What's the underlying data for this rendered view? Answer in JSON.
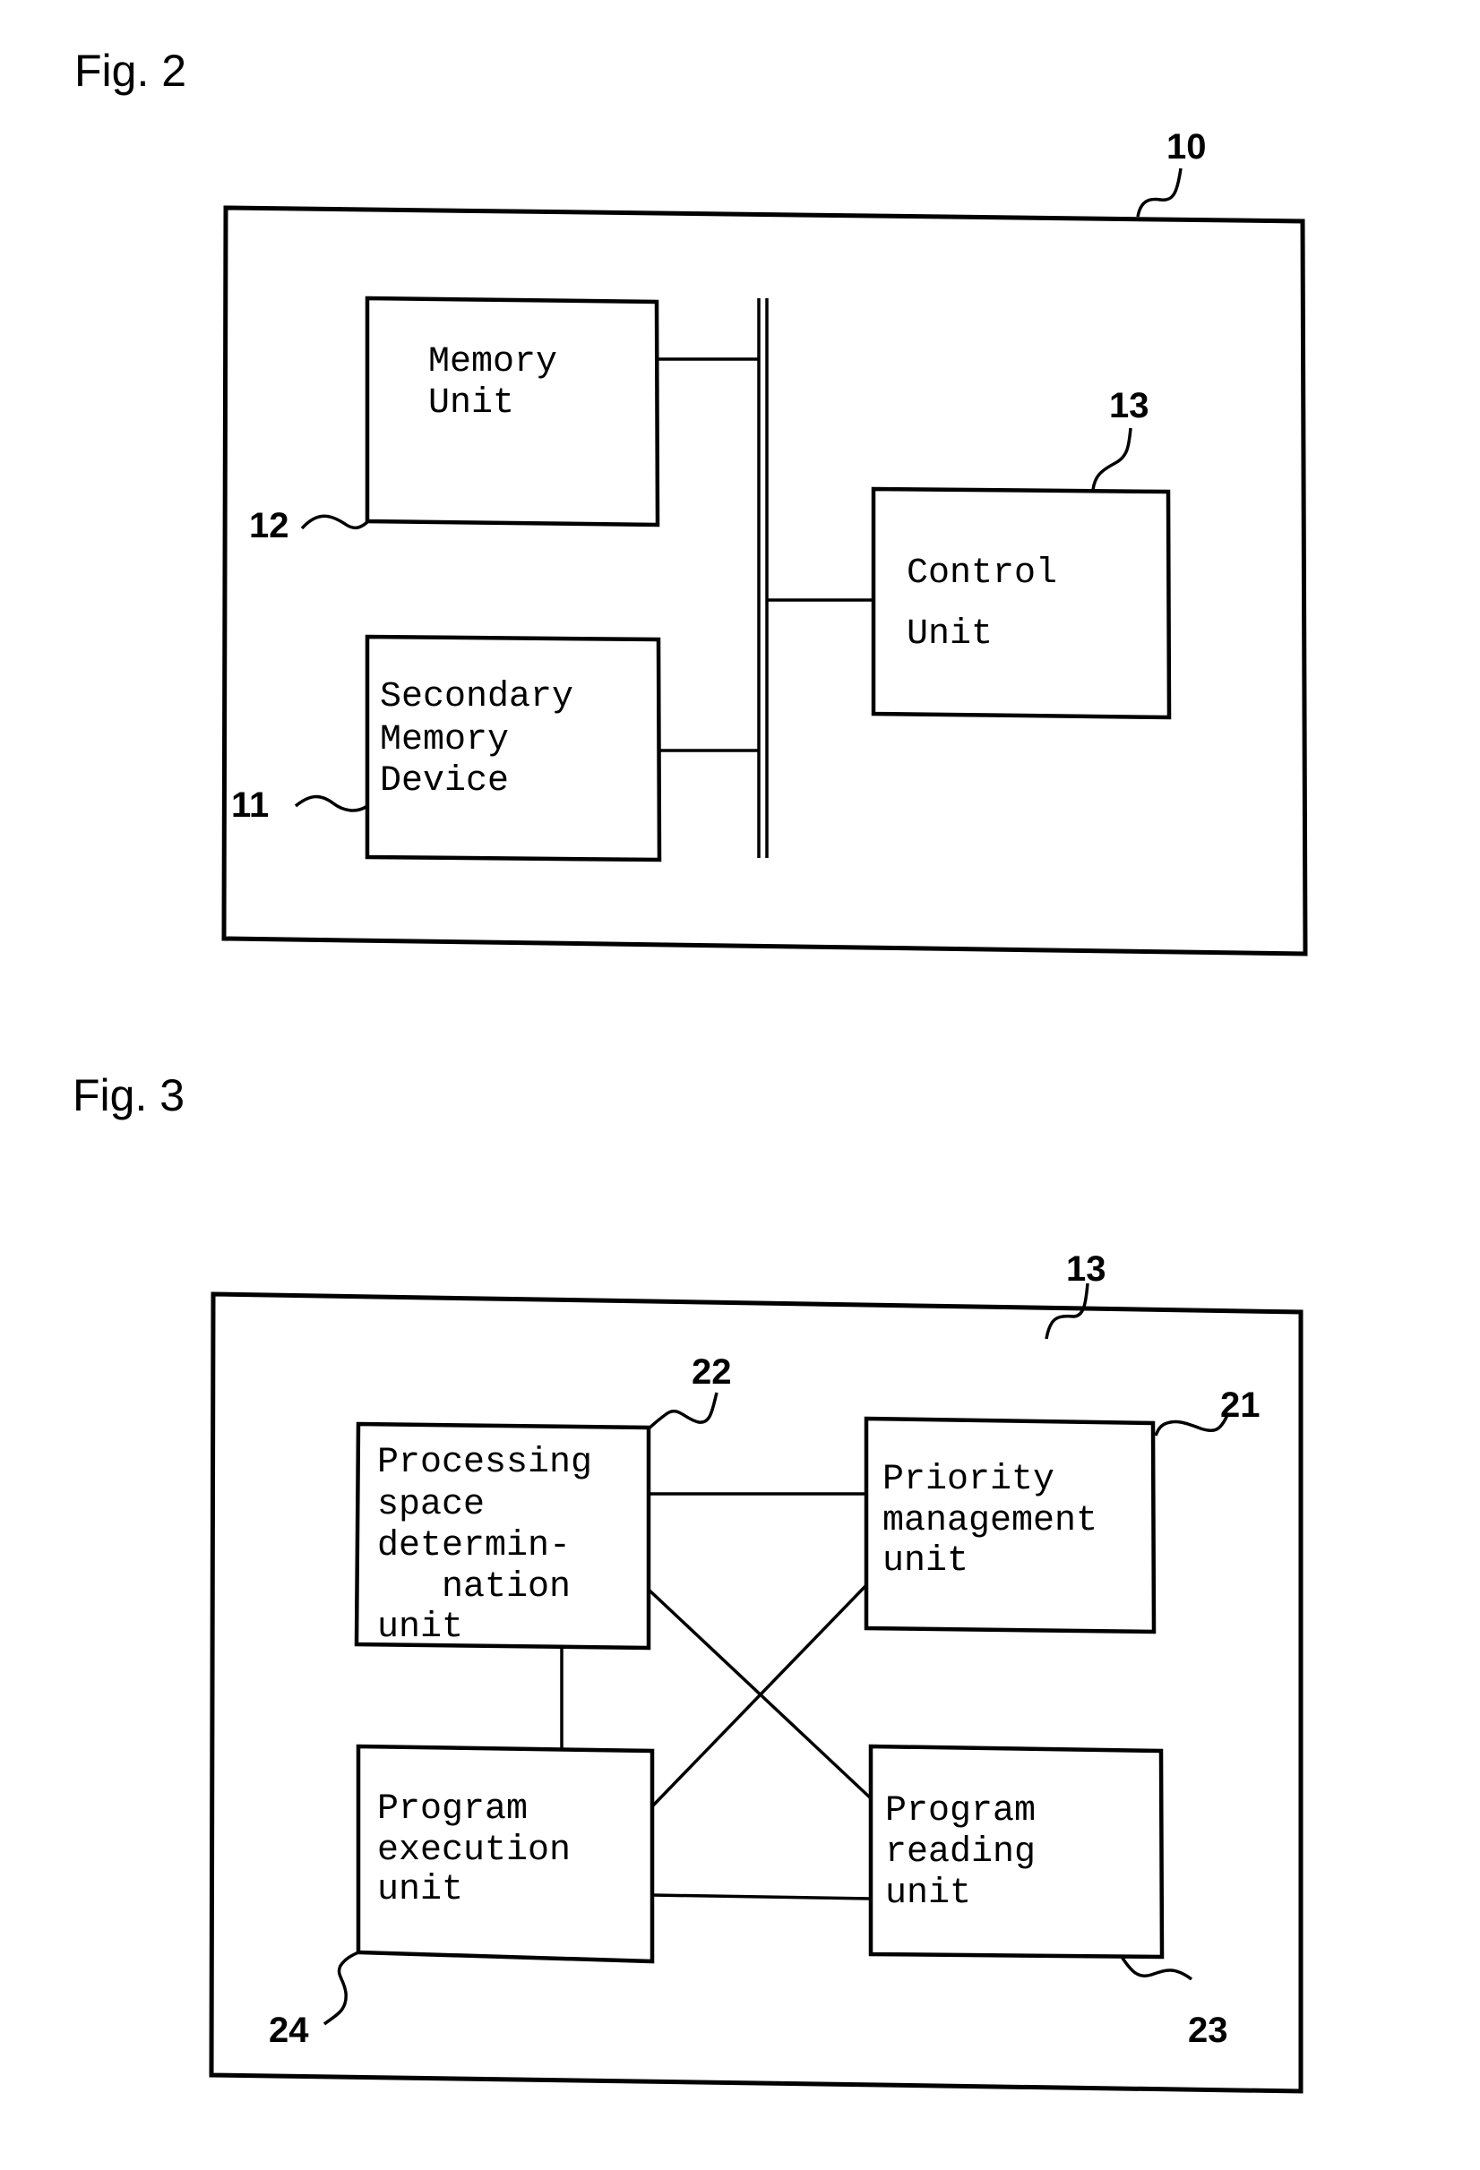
{
  "figures": [
    {
      "title": "Fig. 2",
      "container_ref": "10",
      "bus": "internal-bus",
      "blocks": [
        {
          "ref": "12",
          "lines": [
            "Memory",
            "Unit"
          ]
        },
        {
          "ref": "11",
          "lines": [
            "Secondary",
            "Memory",
            "Device"
          ]
        },
        {
          "ref": "13",
          "lines": [
            "Control",
            "Unit"
          ]
        }
      ],
      "connections": [
        [
          "12",
          "bus"
        ],
        [
          "11",
          "bus"
        ],
        [
          "13",
          "bus"
        ]
      ]
    },
    {
      "title": "Fig. 3",
      "container_ref": "13",
      "blocks": [
        {
          "ref": "22",
          "lines": [
            "Processing",
            "space",
            "determin-",
            "   nation",
            "unit"
          ]
        },
        {
          "ref": "21",
          "lines": [
            "Priority",
            "management",
            "unit"
          ]
        },
        {
          "ref": "24",
          "lines": [
            "Program",
            "execution",
            "unit"
          ]
        },
        {
          "ref": "23",
          "lines": [
            "Program",
            "reading",
            "unit"
          ]
        }
      ],
      "connections": [
        [
          "22",
          "21"
        ],
        [
          "22",
          "24"
        ],
        [
          "22",
          "23"
        ],
        [
          "21",
          "24"
        ],
        [
          "24",
          "23"
        ]
      ]
    }
  ]
}
